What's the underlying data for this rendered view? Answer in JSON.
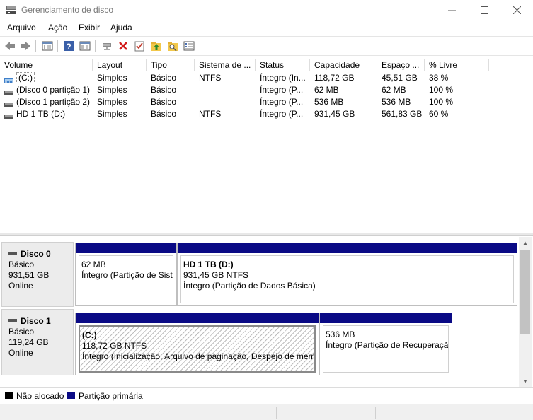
{
  "window": {
    "title": "Gerenciamento de disco",
    "icons": {
      "app": "disk-management-icon",
      "minimize": "minimize-icon",
      "maximize": "maximize-icon",
      "close": "close-icon"
    }
  },
  "menu": [
    "Arquivo",
    "Ação",
    "Exibir",
    "Ajuda"
  ],
  "toolbar": [
    "back-arrow-icon",
    "forward-arrow-icon",
    "properties-icon",
    "help-icon",
    "show-hide-pane-icon",
    "connect-icon",
    "delete-icon",
    "check-icon",
    "up-folder-icon",
    "search-folder-icon",
    "list-view-icon"
  ],
  "columns": [
    "Volume",
    "Layout",
    "Tipo",
    "Sistema de ...",
    "Status",
    "Capacidade",
    "Espaço ...",
    "% Livre"
  ],
  "volumes": [
    {
      "volume": "(C:)",
      "layout": "Simples",
      "tipo": "Básico",
      "sistema": "NTFS",
      "status": "Íntegro (In...",
      "capacidade": "118,72 GB",
      "espaco": "45,51 GB",
      "livre": "38 %"
    },
    {
      "volume": "(Disco 0 partição 1)",
      "layout": "Simples",
      "tipo": "Básico",
      "sistema": "",
      "status": "Íntegro (P...",
      "capacidade": "62 MB",
      "espaco": "62 MB",
      "livre": "100 %"
    },
    {
      "volume": "(Disco 1 partição 2)",
      "layout": "Simples",
      "tipo": "Básico",
      "sistema": "",
      "status": "Íntegro (P...",
      "capacidade": "536 MB",
      "espaco": "536 MB",
      "livre": "100 %"
    },
    {
      "volume": "HD 1 TB (D:)",
      "layout": "Simples",
      "tipo": "Básico",
      "sistema": "NTFS",
      "status": "Íntegro (P...",
      "capacidade": "931,45 GB",
      "espaco": "561,83 GB",
      "livre": "60 %"
    }
  ],
  "disks": [
    {
      "name": "Disco 0",
      "type": "Básico",
      "size": "931,51 GB",
      "state": "Online",
      "partitions": [
        {
          "name": "",
          "size": "62 MB",
          "status": "Íntegro (Partição de Sistema EFI)"
        },
        {
          "name": "HD 1 TB  (D:)",
          "size": "931,45 GB NTFS",
          "status": "Íntegro (Partição de Dados Básica)"
        }
      ]
    },
    {
      "name": "Disco 1",
      "type": "Básico",
      "size": "119,24 GB",
      "state": "Online",
      "partitions": [
        {
          "name": "(C:)",
          "size": "118,72 GB NTFS",
          "status": "Íntegro (Inicialização, Arquivo de paginação, Despejo de memória)"
        },
        {
          "name": "",
          "size": "536 MB",
          "status": "Íntegro (Partição de Recuperação)"
        }
      ]
    }
  ],
  "legend": [
    {
      "label": "Não alocado",
      "color": "#000000"
    },
    {
      "label": "Partição primária",
      "color": "#0a0a85"
    }
  ]
}
